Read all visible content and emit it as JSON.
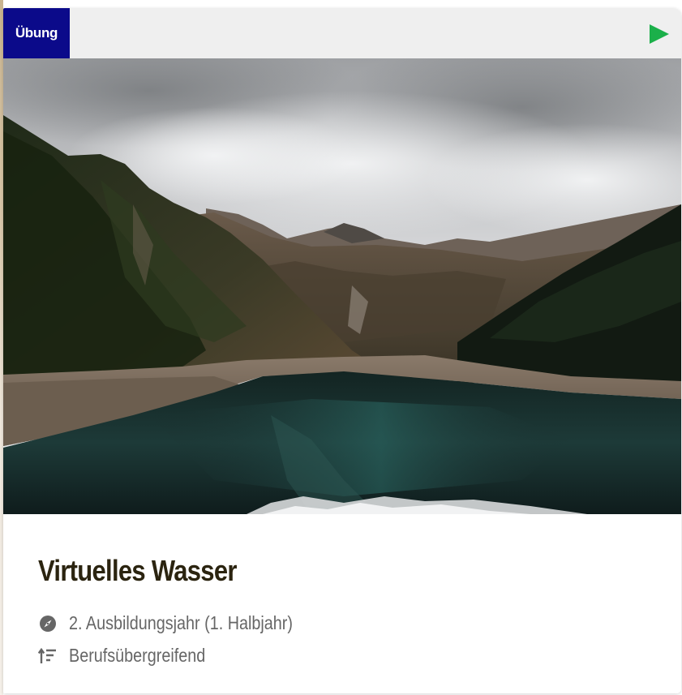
{
  "card": {
    "type_badge": "Übung",
    "play_icon": "play-icon",
    "title": "Virtuelles Wasser",
    "meta": {
      "year": {
        "icon": "compass-icon",
        "label": "2. Ausbildungsjahr (1. Halbjahr)"
      },
      "subject": {
        "icon": "sort-icon",
        "label": "Berufsübergreifend"
      }
    },
    "image_alt": "Bergsee mit bewölkten Bergen",
    "colors": {
      "badge": "#0b0a8a",
      "play": "#1bb04a",
      "title": "#2b2410",
      "meta_text": "#666666",
      "header_bg": "#efefef"
    }
  }
}
